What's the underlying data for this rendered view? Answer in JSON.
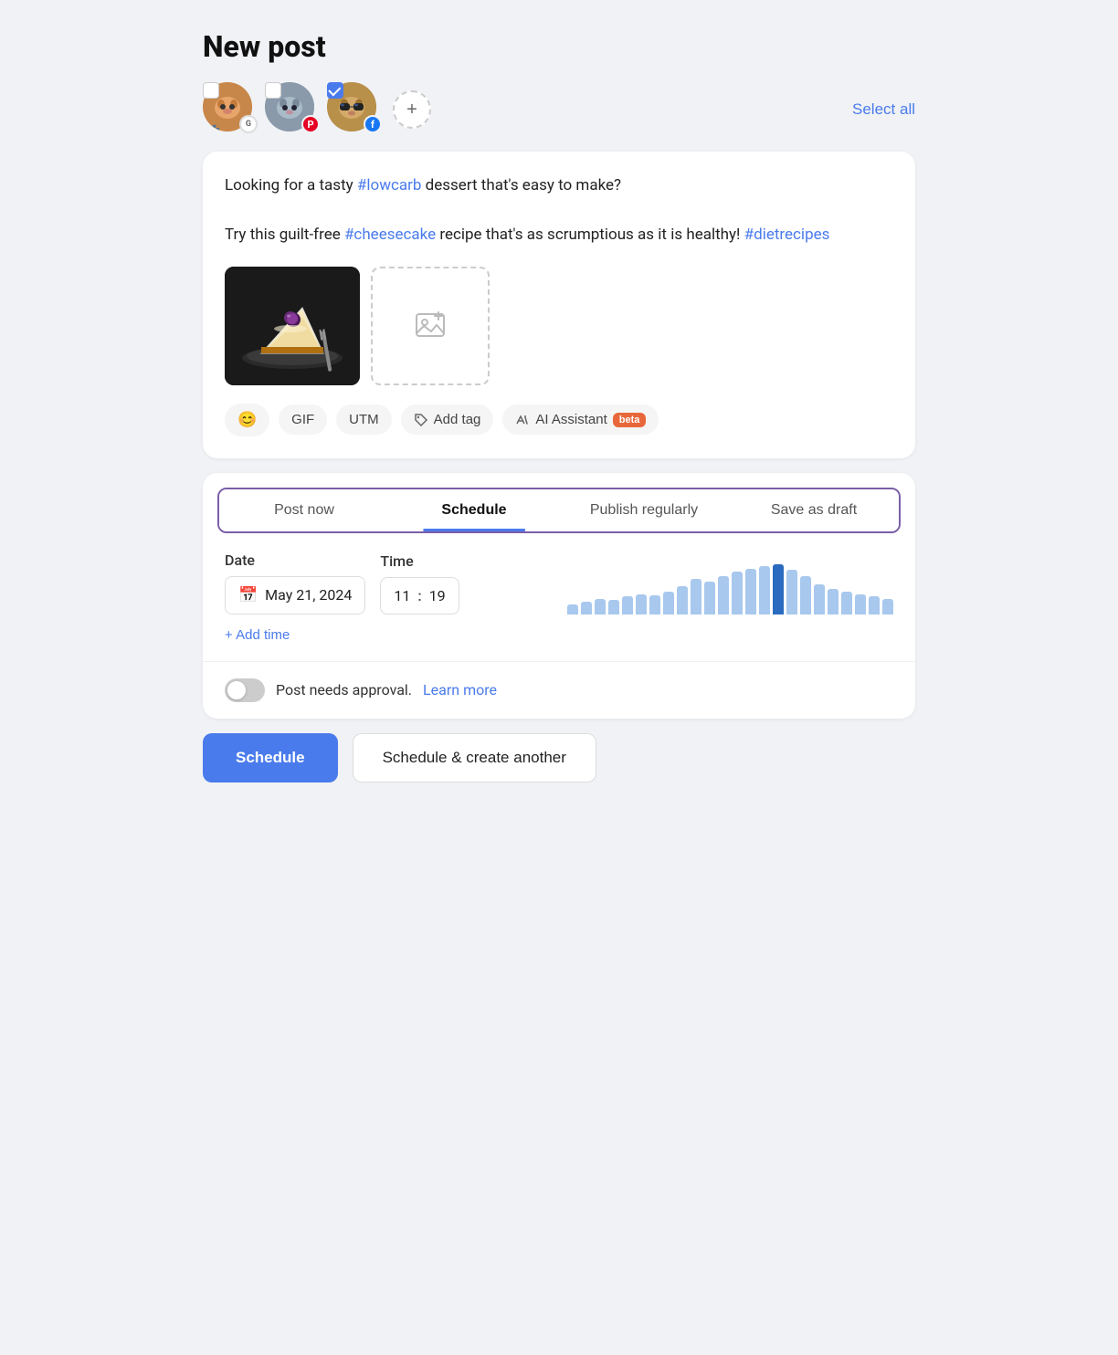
{
  "page": {
    "title": "New post"
  },
  "accounts": [
    {
      "id": "acc1",
      "type": "cat-orange",
      "emoji": "🐱",
      "checked": false,
      "social": "G",
      "social_type": "google"
    },
    {
      "id": "acc2",
      "type": "cat-grey",
      "emoji": "🐱",
      "checked": false,
      "social": "P",
      "social_type": "pinterest"
    },
    {
      "id": "acc3",
      "type": "cat-sunglasses",
      "emoji": "😎",
      "checked": true,
      "social": "f",
      "social_type": "facebook"
    }
  ],
  "select_all_label": "Select all",
  "post": {
    "text_part1": "Looking for a tasty ",
    "hashtag1": "#lowcarb",
    "text_part2": " dessert that's easy to make?",
    "text_part3": "\n\nTry this guilt-free ",
    "hashtag2": "#cheesecake",
    "text_part4": " recipe that's as scrumptious as it is healthy! ",
    "hashtag3": "#dietrecipes"
  },
  "toolbar": {
    "emoji_label": "😊",
    "gif_label": "GIF",
    "utm_label": "UTM",
    "tag_label": "Add tag",
    "ai_label": "AI Assistant",
    "ai_badge": "beta"
  },
  "tabs": [
    {
      "id": "post-now",
      "label": "Post now",
      "active": false
    },
    {
      "id": "schedule",
      "label": "Schedule",
      "active": true
    },
    {
      "id": "publish-regularly",
      "label": "Publish regularly",
      "active": false
    },
    {
      "id": "save-as-draft",
      "label": "Save as draft",
      "active": false
    }
  ],
  "schedule": {
    "date_label": "Date",
    "time_label": "Time",
    "date_value": "May 21, 2024",
    "time_hour": "11",
    "time_minute": "19",
    "add_time_label": "+ Add time",
    "bar_data": [
      20,
      25,
      30,
      28,
      35,
      40,
      38,
      45,
      55,
      70,
      65,
      75,
      85,
      90,
      95,
      100,
      88,
      75,
      60,
      50,
      45,
      40,
      35,
      30
    ],
    "bar_highlight_index": 15,
    "bar_color_normal": "#a8c8ee",
    "bar_color_highlight": "#2a6bbf"
  },
  "approval": {
    "text": "Post needs approval.",
    "link_text": "Learn more",
    "enabled": false
  },
  "footer": {
    "schedule_label": "Schedule",
    "schedule_another_label": "Schedule & create another"
  }
}
